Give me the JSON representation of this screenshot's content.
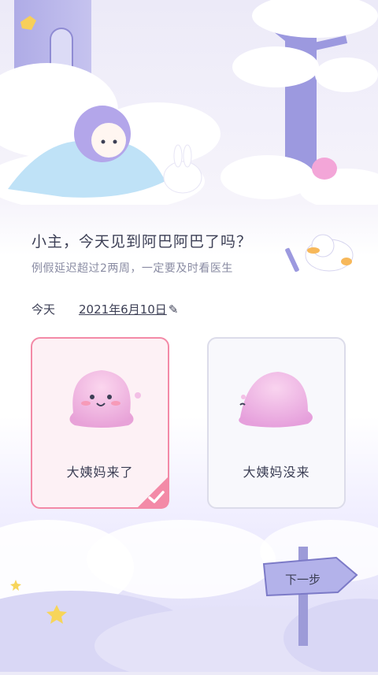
{
  "prompt": {
    "title": "小主，今天见到阿巴阿巴了吗？",
    "subtitle": "例假延迟超过2两周，一定要及时看医生"
  },
  "date": {
    "label": "今天",
    "value": "2021年6月10日"
  },
  "options": [
    {
      "label": "大姨妈来了",
      "selected": true
    },
    {
      "label": "大姨妈没来",
      "selected": false
    }
  ],
  "next_button": {
    "label": "下一步"
  },
  "icons": {
    "edit": "pencil-icon",
    "check": "checkmark-icon"
  },
  "colors": {
    "accent": "#f38aa7",
    "text": "#3c3f55",
    "muted": "#8a8ca3"
  }
}
